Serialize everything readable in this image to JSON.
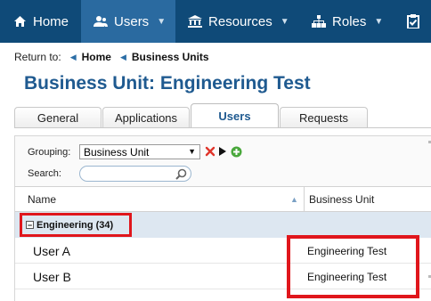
{
  "nav": {
    "items": [
      {
        "label": "Home",
        "icon": "home-icon",
        "caret": false
      },
      {
        "label": "Users",
        "icon": "users-icon",
        "caret": true
      },
      {
        "label": "Resources",
        "icon": "bank-icon",
        "caret": true
      },
      {
        "label": "Roles",
        "icon": "sitemap-icon",
        "caret": true
      }
    ],
    "active": "Users",
    "bg_color": "#0f4a78",
    "active_color": "#2a6aa0"
  },
  "breadcrumb": {
    "prefix": "Return to:",
    "items": [
      "Home",
      "Business Units"
    ]
  },
  "page_title": "Business Unit: Engineering Test",
  "tabs": {
    "items": [
      "General",
      "Applications",
      "Users",
      "Requests"
    ],
    "active": "Users"
  },
  "toolbar": {
    "grouping_label": "Grouping:",
    "grouping_value": "Business Unit",
    "search_label": "Search:",
    "search_value": ""
  },
  "grid": {
    "columns": [
      "Name",
      "Business Unit"
    ],
    "group": {
      "label": "Engineering (34)"
    },
    "rows": [
      {
        "name": "User A",
        "business_unit": "Engineering Test"
      },
      {
        "name": "User B",
        "business_unit": "Engineering Test"
      }
    ]
  },
  "colors": {
    "title": "#1f5a90",
    "highlight": "#e0161c",
    "group_row": "#dde7f1"
  }
}
